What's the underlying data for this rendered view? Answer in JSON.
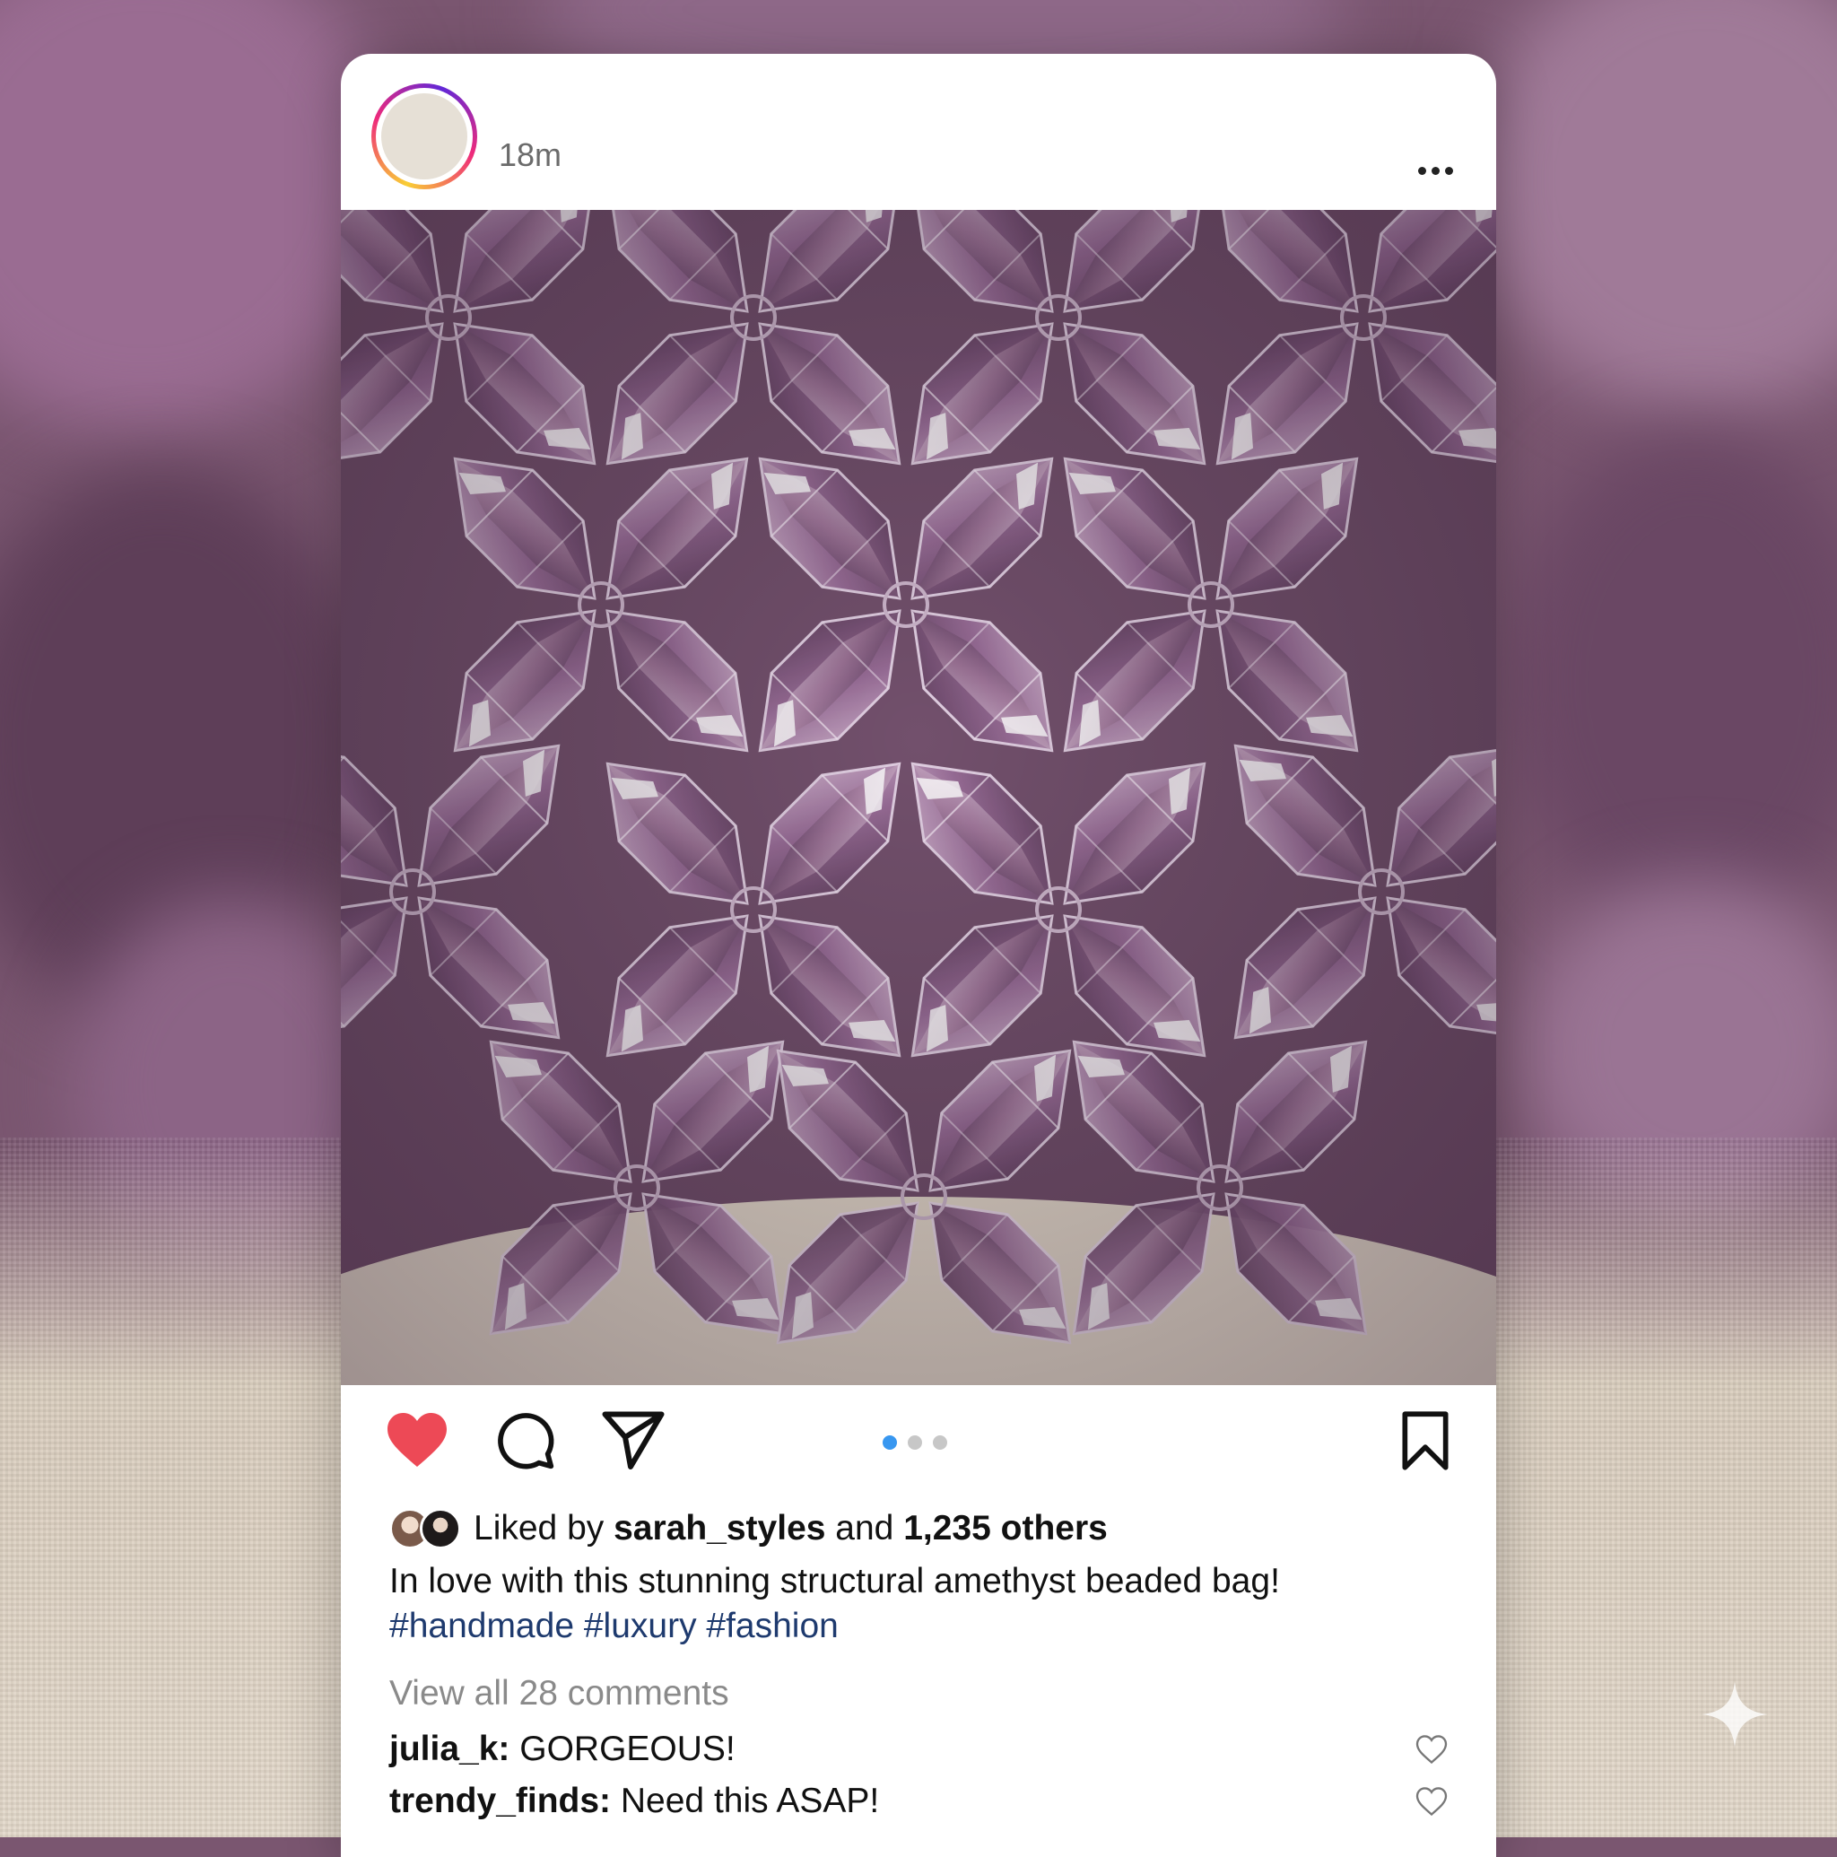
{
  "post": {
    "timestamp": "18m",
    "image_alt": "Close-up of amethyst faceted crystal beads woven into a structural pattern",
    "carousel": {
      "total": 3,
      "active_index": 0
    }
  },
  "actions": {
    "liked": true,
    "colors": {
      "heart": "#ed4956",
      "active_dot": "#3897f0",
      "inactive_dot": "#c7c7c7",
      "hashtag": "#1e3a6e"
    }
  },
  "likes": {
    "prefix": "Liked by ",
    "user": "sarah_styles",
    "middle": " and ",
    "count_text": "1,235 others"
  },
  "caption": {
    "text": "In love with this stunning structural amethyst beaded bag!",
    "hashtags": "#handmade #luxury #fashion"
  },
  "comments_link": "View all 28 comments",
  "comments": [
    {
      "user": "julia_k",
      "separator": ": ",
      "text": "GORGEOUS!"
    },
    {
      "user": "trendy_finds",
      "separator": ": ",
      "text": "Need this ASAP!"
    }
  ]
}
